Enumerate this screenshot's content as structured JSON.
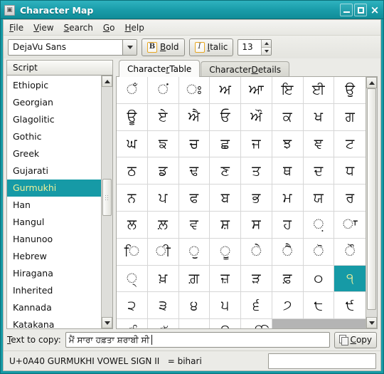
{
  "window": {
    "title": "Character Map",
    "icon": "app-icon",
    "buttons": {
      "minimize": "minimize-icon",
      "maximize": "maximize-icon",
      "close": "×"
    },
    "colors": {
      "titlebar": "#169aa6",
      "selection": "#169aa6",
      "selection_text": "#eff09a",
      "accent_orange": "#e8a823"
    }
  },
  "menubar": [
    {
      "label": "File",
      "mnemonic": "F"
    },
    {
      "label": "View",
      "mnemonic": "V"
    },
    {
      "label": "Search",
      "mnemonic": "S"
    },
    {
      "label": "Go",
      "mnemonic": "G"
    },
    {
      "label": "Help",
      "mnemonic": "H"
    }
  ],
  "toolbar": {
    "font_combo": {
      "value": "DejaVu Sans",
      "arrow": "chevron-down-icon"
    },
    "bold": {
      "label": "Bold",
      "mnemonic": "B",
      "icon_glyph": "B"
    },
    "italic": {
      "label": "Italic",
      "mnemonic": "I",
      "icon_glyph": "I"
    },
    "font_size": "13"
  },
  "sidebar": {
    "header": "Script",
    "selected": "Gurmukhi",
    "items": [
      "Ethiopic",
      "Georgian",
      "Glagolitic",
      "Gothic",
      "Greek",
      "Gujarati",
      "Gurmukhi",
      "Han",
      "Hangul",
      "Hanunoo",
      "Hebrew",
      "Hiragana",
      "Inherited",
      "Kannada",
      "Katakana"
    ],
    "scrollbar": {
      "thumb_top_pct": 40,
      "thumb_height_pct": 16
    }
  },
  "tabs": [
    {
      "label": "Character Table",
      "mnemonic": "r",
      "active": true
    },
    {
      "label": "Character Details",
      "mnemonic": "D",
      "active": false
    }
  ],
  "char_table": {
    "columns": 8,
    "selected_index": 63,
    "scrollbar": {
      "thumb_top_pct": 0,
      "thumb_height_pct": 97
    },
    "cells": [
      "ਁ",
      "ਂ",
      "ਃ",
      "ਅ",
      "ਆ",
      "ਇ",
      "ਈ",
      "ਉ",
      "ਊ",
      "ਏ",
      "ਐ",
      "ਓ",
      "ਔ",
      "ਕ",
      "ਖ",
      "ਗ",
      "ਘ",
      "ਙ",
      "ਚ",
      "ਛ",
      "ਜ",
      "ਝ",
      "ਞ",
      "ਟ",
      "ਠ",
      "ਡ",
      "ਢ",
      "ਣ",
      "ਤ",
      "ਥ",
      "ਦ",
      "ਧ",
      "ਨ",
      "ਪ",
      "ਫ",
      "ਬ",
      "ਭ",
      "ਮ",
      "ਯ",
      "ਰ",
      "ਲ",
      "ਲ਼",
      "ਵ",
      "ਸ਼",
      "ਸ",
      "ਹ",
      "਼",
      "ਾ",
      "ਿ",
      "ੀ",
      "ੁ",
      "ੂ",
      "ੇ",
      "ੈ",
      "ੋ",
      "ੌ",
      "੍",
      "ਖ਼",
      "ਗ਼",
      "ਜ਼",
      "ੜ",
      "ਫ਼",
      "੦",
      "੧",
      "੨",
      "੩",
      "੪",
      "੫",
      "੬",
      "੭",
      "੮",
      "੯",
      "ੰ",
      "ੱ",
      "ੲ",
      "ੳ",
      "ੴ",
      "",
      "",
      ""
    ]
  },
  "copybar": {
    "label": "Text to copy:",
    "mnemonic": "T",
    "value": "ਮੈਂ ਸਾਰਾ ਹਫ਼ਤਾ ਸ਼ਰਾਬੀ ਸੀ",
    "button": {
      "label": "Copy",
      "mnemonic": "C",
      "icon": "copy-icon"
    }
  },
  "statusbar": {
    "text": "U+0A40 GURMUKHI VOWEL SIGN II   = bihari",
    "side_field_value": ""
  }
}
